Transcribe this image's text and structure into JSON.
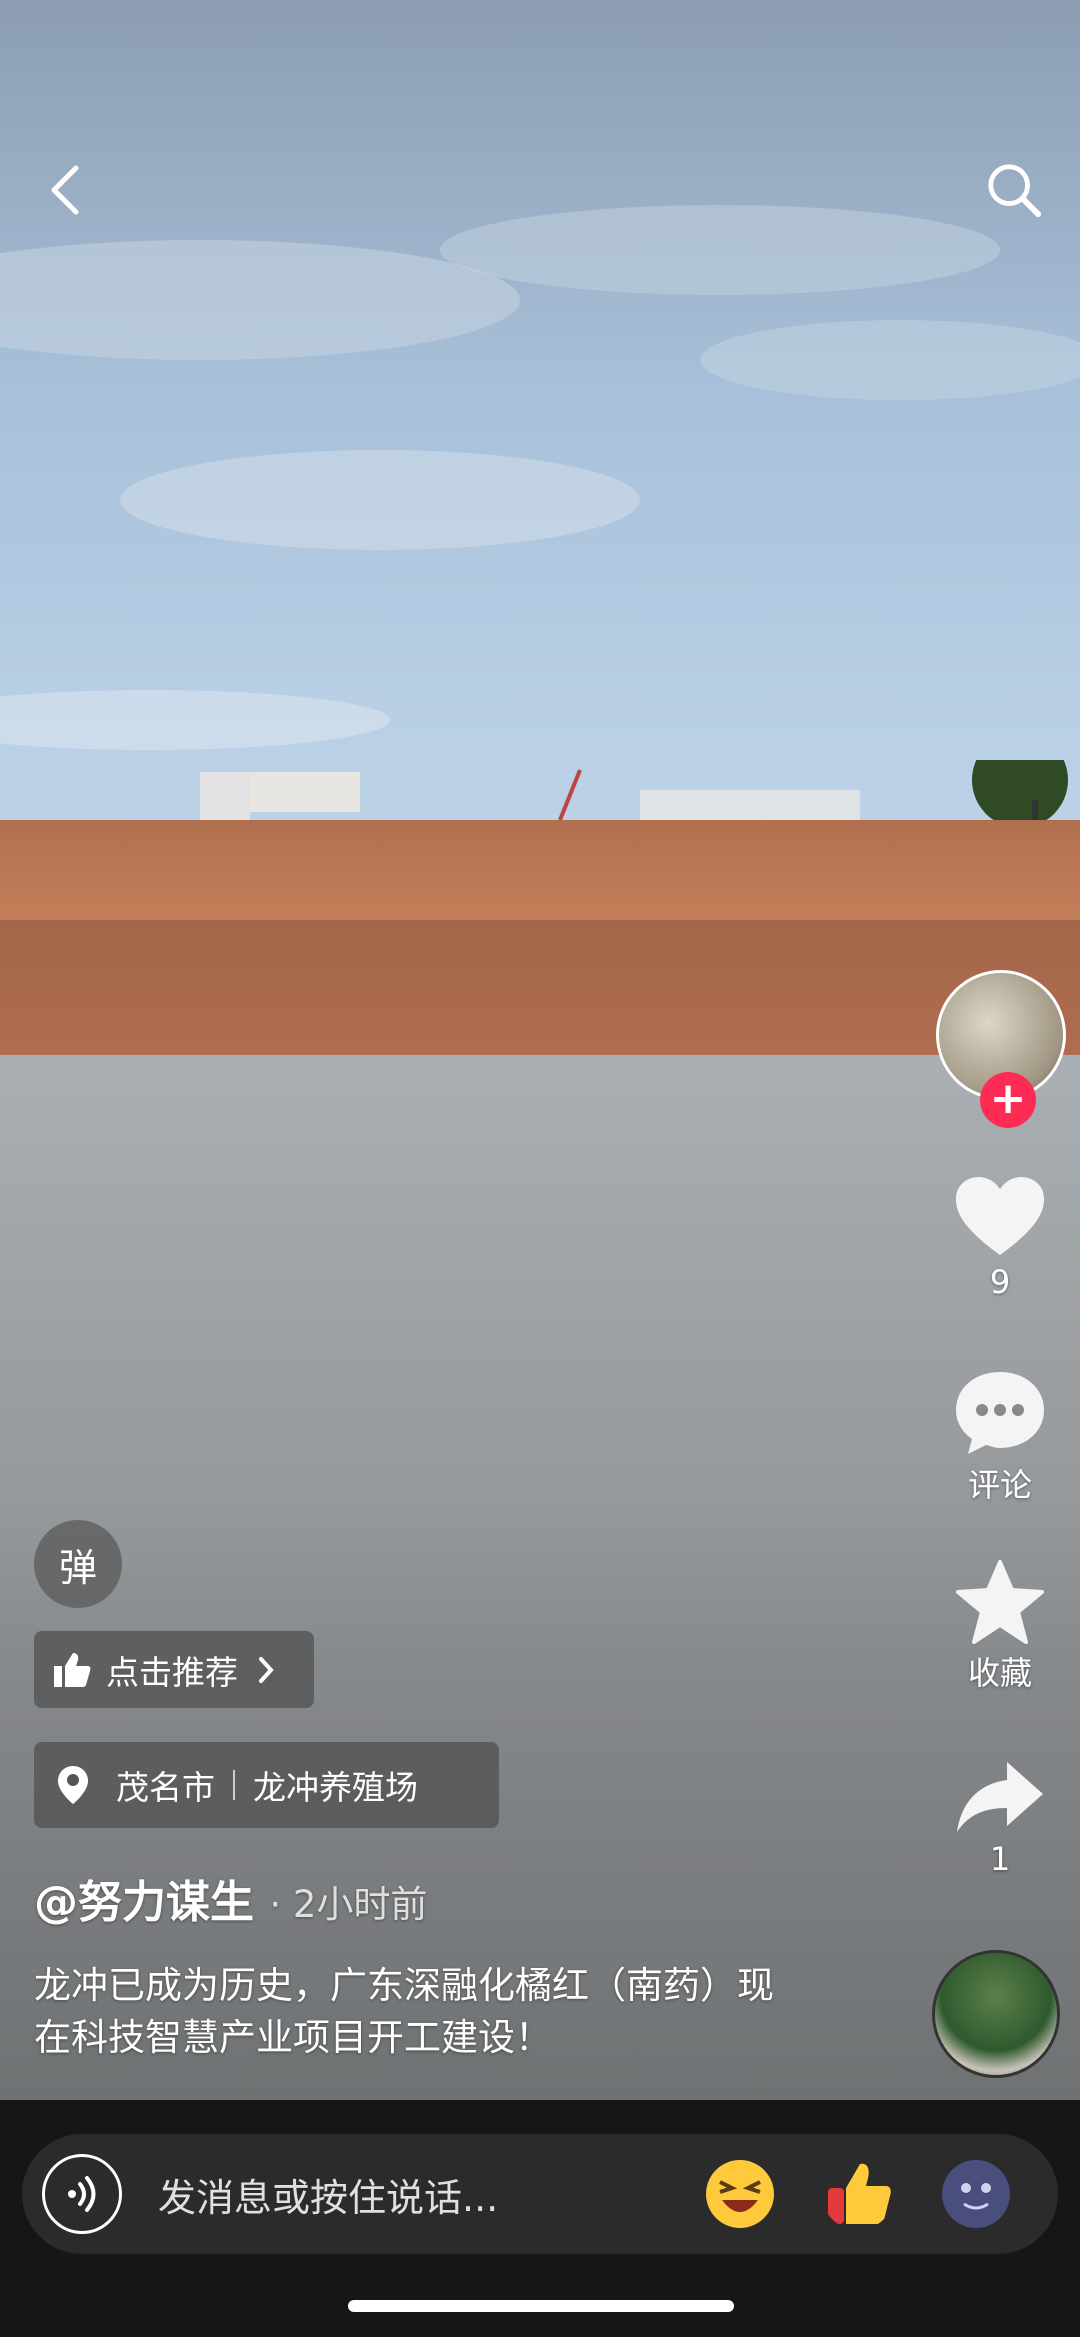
{
  "stats": {
    "likes": "9",
    "comments_label": "评论",
    "favorites_label": "收藏",
    "shares": "1"
  },
  "danmu_label": "弹",
  "recommend_label": "点击推荐",
  "location": {
    "city": "茂名市",
    "place": "龙冲养殖场"
  },
  "author": {
    "name": "@努力谋生",
    "time": "· 2小时前"
  },
  "description": "龙冲已成为历史，广东深融化橘红（南药）现在科技智慧产业项目开工建设！",
  "input": {
    "placeholder": "发消息或按住说话..."
  },
  "icons": {
    "back": "chevron-left-icon",
    "search": "search-icon",
    "like": "heart-icon",
    "comment": "comment-bubble-icon",
    "favorite": "star-icon",
    "share": "share-arrow-icon",
    "thumb": "thumbs-up-icon",
    "location": "location-pin-icon",
    "voice": "voice-icon"
  },
  "colors": {
    "accent": "#fe2c55",
    "bar": "#161616",
    "input": "#2b2b2b"
  }
}
